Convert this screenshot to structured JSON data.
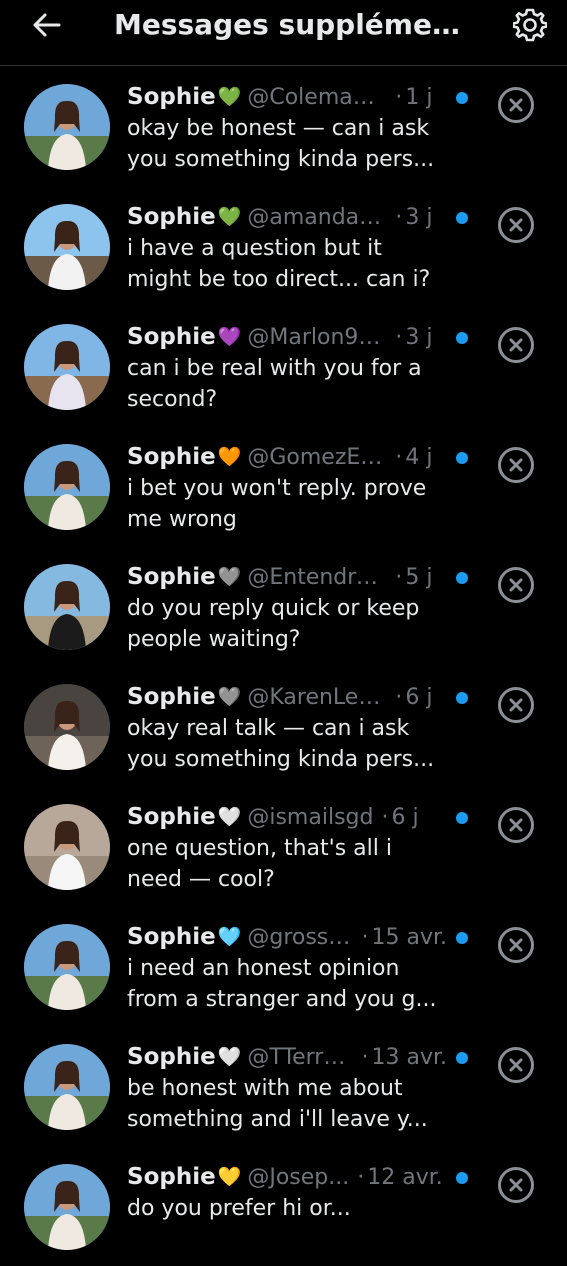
{
  "header": {
    "title": "Messages supplémen..."
  },
  "colors": {
    "background": "#000000",
    "text": "#e7e9ea",
    "muted": "#71767b",
    "unread": "#1d9bf0"
  },
  "icons": {
    "back": "arrow-left-icon",
    "settings": "gear-icon",
    "dismiss": "close-circle-icon",
    "unread": "unread-dot-icon"
  },
  "requests": [
    {
      "name": "Sophie",
      "heart": "💚",
      "heart_color": "#5fd35f",
      "handle": "@ColemanE...",
      "time": "1 j",
      "message": "okay be honest — can i ask you something kinda pers..."
    },
    {
      "name": "Sophie",
      "heart": "💚",
      "heart_color": "#5fd35f",
      "handle": "@amanda_h...",
      "time": "3 j",
      "message": "i have a question but it might be too direct... can i?"
    },
    {
      "name": "Sophie",
      "heart": "💜",
      "heart_color": "#a65ee8",
      "handle": "@Marlon97...",
      "time": "3 j",
      "message": "can i be real with you for a second?"
    },
    {
      "name": "Sophie",
      "heart": "🧡",
      "heart_color": "#f4901e",
      "handle": "@GomezEb...",
      "time": "4 j",
      "message": "i bet you won't reply. prove me wrong"
    },
    {
      "name": "Sophie",
      "heart": "🩶",
      "heart_color": "#9a9a9a",
      "handle": "@EntendreL...",
      "time": "5 j",
      "message": "do you reply quick or keep people waiting?"
    },
    {
      "name": "Sophie",
      "heart": "🩶",
      "heart_color": "#9a9a9a",
      "handle": "@KarenLe41...",
      "time": "6 j",
      "message": "okay real talk — can i ask you something kinda pers..."
    },
    {
      "name": "Sophie",
      "heart": "🤍",
      "heart_color": "#f0f0f0",
      "handle": "@ismailsgd",
      "time": "6 j",
      "message": "one question, that's all i need — cool?"
    },
    {
      "name": "Sophie",
      "heart": "🩵",
      "heart_color": "#5bc8f0",
      "handle": "@gross7...",
      "time": "15 avr.",
      "message": "i need an honest opinion from a stranger and you g..."
    },
    {
      "name": "Sophie",
      "heart": "🤍",
      "heart_color": "#f0f0f0",
      "handle": "@TTerry...",
      "time": "13 avr.",
      "message": "be honest with me about something and i'll leave y..."
    },
    {
      "name": "Sophie",
      "heart": "💛",
      "heart_color": "#f5c518",
      "handle": "@Josep...",
      "time": "12 avr.",
      "message": "do you prefer hi or..."
    }
  ]
}
